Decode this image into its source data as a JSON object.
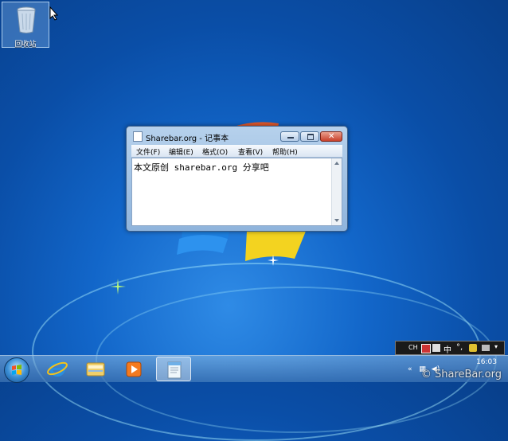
{
  "desktop": {
    "recycle_bin_label": "回收站"
  },
  "notepad": {
    "title": "Sharebar.org - 记事本",
    "menu": [
      "文件(F)",
      "编辑(E)",
      "格式(O)",
      "查看(V)",
      "帮助(H)"
    ],
    "content": "本文原创 sharebar.org 分享吧"
  },
  "taskbar": {
    "apps": [
      "start-orb",
      "internet-explorer",
      "windows-explorer",
      "media-player",
      "notepad"
    ],
    "active_app": "notepad"
  },
  "language_bar": {
    "code": "CH",
    "ime_text": "中"
  },
  "tray": {
    "time": "16:03",
    "watermark": "© ShareBar.org"
  },
  "colors": {
    "desktop_blue": "#1266c9",
    "close_red": "#c8412c",
    "window_frame": "#b6d1ec"
  }
}
